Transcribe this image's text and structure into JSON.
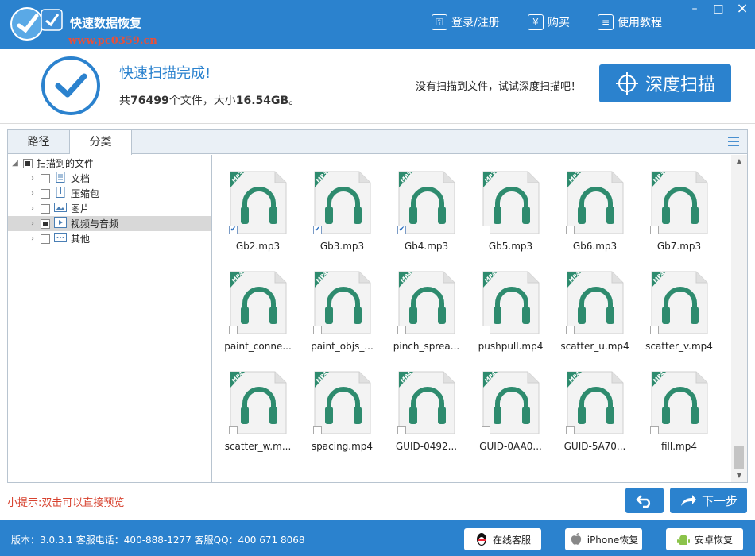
{
  "titlebar": {
    "app_title": "快速数据恢复",
    "watermark": "www.pc0359.cn",
    "login_label": "登录/注册",
    "buy_label": "购买",
    "tutorial_label": "使用教程",
    "minimize": "–",
    "maximize": "□",
    "close": "×"
  },
  "header": {
    "scan_done": "快速扫描完成!",
    "stats_prefix": "共",
    "file_count": "76499",
    "stats_mid": "个文件，大小",
    "total_size": "16.54GB",
    "stats_suffix": "。",
    "deep_hint": "没有扫描到文件，试试深度扫描吧！",
    "deep_scan_label": "深度扫描"
  },
  "tabs": [
    {
      "label": "路径",
      "active": false
    },
    {
      "label": "分类",
      "active": true
    }
  ],
  "tree": {
    "root": "扫描到的文件",
    "items": [
      {
        "label": "文档",
        "icon": "document-icon",
        "state": "unchecked"
      },
      {
        "label": "压缩包",
        "icon": "archive-icon",
        "state": "unchecked"
      },
      {
        "label": "图片",
        "icon": "image-icon",
        "state": "unchecked"
      },
      {
        "label": "视频与音频",
        "icon": "media-icon",
        "state": "partial",
        "selected": true
      },
      {
        "label": "其他",
        "icon": "other-icon",
        "state": "unchecked"
      }
    ]
  },
  "files": [
    {
      "name": "Gb2.mp3",
      "type": "MP3",
      "checked": true
    },
    {
      "name": "Gb3.mp3",
      "type": "MP3",
      "checked": true
    },
    {
      "name": "Gb4.mp3",
      "type": "MP3",
      "checked": true
    },
    {
      "name": "Gb5.mp3",
      "type": "MP3",
      "checked": false
    },
    {
      "name": "Gb6.mp3",
      "type": "MP3",
      "checked": false
    },
    {
      "name": "Gb7.mp3",
      "type": "MP3",
      "checked": false
    },
    {
      "name": "paint_conne...",
      "type": "MP4",
      "checked": false
    },
    {
      "name": "paint_objs_...",
      "type": "MP4",
      "checked": false
    },
    {
      "name": "pinch_sprea...",
      "type": "MP4",
      "checked": false
    },
    {
      "name": "pushpull.mp4",
      "type": "MP4",
      "checked": false
    },
    {
      "name": "scatter_u.mp4",
      "type": "MP4",
      "checked": false
    },
    {
      "name": "scatter_v.mp4",
      "type": "MP4",
      "checked": false
    },
    {
      "name": "scatter_w.m...",
      "type": "MP4",
      "checked": false
    },
    {
      "name": "spacing.mp4",
      "type": "MP4",
      "checked": false
    },
    {
      "name": "GUID-0492...",
      "type": "MP4",
      "checked": false
    },
    {
      "name": "GUID-0AA0...",
      "type": "MP4",
      "checked": false
    },
    {
      "name": "GUID-5A70...",
      "type": "MP4",
      "checked": false
    },
    {
      "name": "fill.mp4",
      "type": "MP4",
      "checked": false
    }
  ],
  "bottom": {
    "tip": "小提示:双击可以直接预览",
    "next_label": "下一步"
  },
  "status": {
    "text": "版本：3.0.3.1  客服电话：400-888-1277     客服QQ：400 671 8068",
    "online_service": "在线客服",
    "iphone_recovery": "iPhone恢复",
    "android_recovery": "安卓恢复"
  },
  "colors": {
    "brand": "#2b82ce",
    "badge": "#2e8b6e",
    "tip": "#d7422f"
  }
}
